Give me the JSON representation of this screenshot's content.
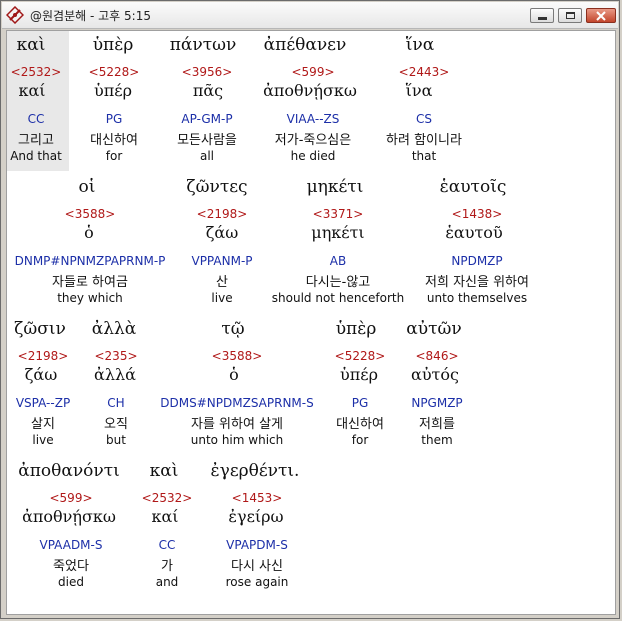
{
  "window": {
    "title": "@원겸분해 - 고후 5:15"
  },
  "lines": [
    {
      "words": [
        {
          "greek": "καὶ",
          "strong": "<2532>",
          "lemma": "καί",
          "parsing": "CC",
          "korean": "그리고",
          "english": "And that"
        },
        {
          "greek": "ὑπὲρ",
          "strong": "<5228>",
          "lemma": "ὑπέρ",
          "parsing": "PG",
          "korean": "대신하여",
          "english": "for"
        },
        {
          "greek": "πάντων",
          "strong": "<3956>",
          "lemma": "πᾶς",
          "parsing": "AP-GM-P",
          "korean": "모든사람을",
          "english": "all"
        },
        {
          "greek": "ἀπέθανεν",
          "strong": "<599>",
          "lemma": "ἀποθνῄσκω",
          "parsing": "VIAA--ZS",
          "korean": "저가-죽으심은",
          "english": "he died"
        },
        {
          "greek": "ἵνα",
          "strong": "<2443>",
          "lemma": "ἵνα",
          "parsing": "CS",
          "korean": "하려 함이니라",
          "english": "that"
        }
      ]
    },
    {
      "words": [
        {
          "greek": "οἱ",
          "strong": "<3588>",
          "lemma": "ὁ",
          "parsing": "DNMP#NPNMZPAPRNM-P",
          "korean": "자들로 하여금",
          "english": "they which"
        },
        {
          "greek": "ζῶντες",
          "strong": "<2198>",
          "lemma": "ζάω",
          "parsing": "VPPANM-P",
          "korean": "산",
          "english": "live"
        },
        {
          "greek": "μηκέτι",
          "strong": "<3371>",
          "lemma": "μηκέτι",
          "parsing": "AB",
          "korean": "다시는-않고",
          "english": "should not henceforth"
        },
        {
          "greek": "ἑαυτοῖς",
          "strong": "<1438>",
          "lemma": "ἑαυτοῦ",
          "parsing": "NPDMZP",
          "korean": "저희 자신을 위하여",
          "english": "unto themselves"
        }
      ]
    },
    {
      "words": [
        {
          "greek": "ζῶσιν",
          "strong": "<2198>",
          "lemma": "ζάω",
          "parsing": "VSPA--ZP",
          "korean": "살지",
          "english": "live"
        },
        {
          "greek": "ἀλλὰ",
          "strong": "<235>",
          "lemma": "ἀλλά",
          "parsing": "CH",
          "korean": "오직",
          "english": "but"
        },
        {
          "greek": "τῷ",
          "strong": "<3588>",
          "lemma": "ὁ",
          "parsing": "DDMS#NPDMZSAPRNM-S",
          "korean": "자를 위하여 살게",
          "english": "unto him which"
        },
        {
          "greek": "ὑπὲρ",
          "strong": "<5228>",
          "lemma": "ὑπέρ",
          "parsing": "PG",
          "korean": "대신하여",
          "english": "for"
        },
        {
          "greek": "αὐτῶν",
          "strong": "<846>",
          "lemma": "αὐτός",
          "parsing": "NPGMZP",
          "korean": "저희를",
          "english": "them"
        }
      ]
    },
    {
      "words": [
        {
          "greek": "ἀποθανόντι",
          "strong": "<599>",
          "lemma": "ἀποθνῄσκω",
          "parsing": "VPAADM-S",
          "korean": "죽었다",
          "english": "died"
        },
        {
          "greek": "καὶ",
          "strong": "<2532>",
          "lemma": "καί",
          "parsing": "CC",
          "korean": "가",
          "english": "and"
        },
        {
          "greek": "ἐγερθέντι.",
          "strong": "<1453>",
          "lemma": "ἐγείρω",
          "parsing": "VPAPDM-S",
          "korean": "다시 사신",
          "english": "rose again"
        }
      ]
    }
  ]
}
